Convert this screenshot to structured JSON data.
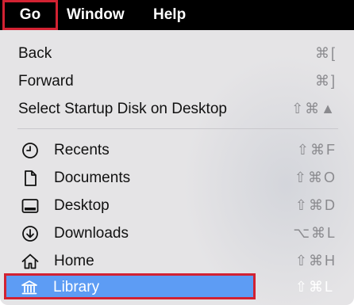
{
  "menubar": {
    "items": [
      {
        "label": "Go"
      },
      {
        "label": "Window"
      },
      {
        "label": "Help"
      }
    ]
  },
  "menu": {
    "group1": [
      {
        "label": "Back",
        "shortcut": "⌘["
      },
      {
        "label": "Forward",
        "shortcut": "⌘]"
      },
      {
        "label": "Select Startup Disk on Desktop",
        "shortcut": "⇧⌘▲"
      }
    ],
    "group2": [
      {
        "label": "Recents",
        "icon": "clock-icon",
        "shortcut": "⇧⌘F"
      },
      {
        "label": "Documents",
        "icon": "document-icon",
        "shortcut": "⇧⌘O"
      },
      {
        "label": "Desktop",
        "icon": "desktop-icon",
        "shortcut": "⇧⌘D"
      },
      {
        "label": "Downloads",
        "icon": "download-icon",
        "shortcut": "⌥⌘L"
      },
      {
        "label": "Home",
        "icon": "home-icon",
        "shortcut": "⇧⌘H"
      },
      {
        "label": "Library",
        "icon": "library-icon",
        "shortcut": "⇧⌘L",
        "selected": true
      }
    ]
  },
  "colors": {
    "menubar_bg": "#000000",
    "menu_bg": "#e5e4e6",
    "highlight": "#5d9cf4",
    "annotation_red": "#d22232"
  }
}
